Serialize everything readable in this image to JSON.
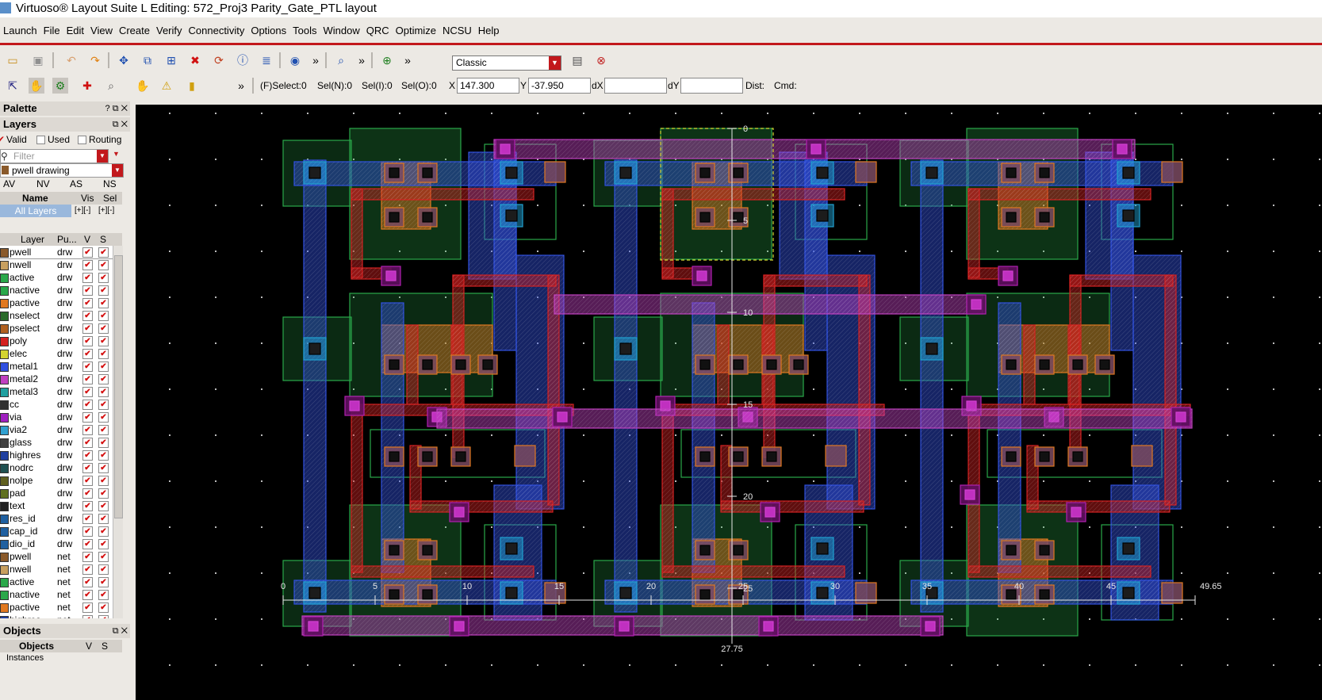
{
  "title": "Virtuoso® Layout Suite L Editing: 572_Proj3 Parity_Gate_PTL layout",
  "menu": [
    "Launch",
    "File",
    "Edit",
    "View",
    "Create",
    "Verify",
    "Connectivity",
    "Options",
    "Tools",
    "Window",
    "QRC",
    "Optimize",
    "NCSU",
    "Help"
  ],
  "toolbar": {
    "workspace": "Classic",
    "more": "»"
  },
  "status": {
    "f_select": "(F)Select:0",
    "sel_n": "Sel(N):0",
    "sel_i": "Sel(I):0",
    "sel_o": "Sel(O):0",
    "x_label": "X",
    "x_value": "147.300",
    "y_label": "Y",
    "y_value": "-37.950",
    "dx_label": "dX",
    "dx_value": "",
    "dy_label": "dY",
    "dy_value": "",
    "dist_label": "Dist:",
    "cmd_label": "Cmd:"
  },
  "palette": {
    "title": "Palette",
    "layers_title": "Layers",
    "valid": "Valid",
    "used": "Used",
    "routing": "Routing",
    "filter_placeholder": "Filter",
    "current_layer": "pwell drawing",
    "tabs": [
      "AV",
      "NV",
      "AS",
      "NS"
    ],
    "name_header": "Name",
    "vis_header": "Vis",
    "sel_header": "Sel",
    "all_layers": "All Layers",
    "col_layer": "Layer",
    "col_purpose": "Pu...",
    "col_v": "V",
    "col_s": "S",
    "layers": [
      {
        "name": "pwell",
        "purpose": "drw",
        "color": "#8a5a2b"
      },
      {
        "name": "nwell",
        "purpose": "drw",
        "color": "#c8a060"
      },
      {
        "name": "active",
        "purpose": "drw",
        "color": "#2aa84a"
      },
      {
        "name": "nactive",
        "purpose": "drw",
        "color": "#2aa84a"
      },
      {
        "name": "pactive",
        "purpose": "drw",
        "color": "#e07820"
      },
      {
        "name": "nselect",
        "purpose": "drw",
        "color": "#2a6a2a"
      },
      {
        "name": "pselect",
        "purpose": "drw",
        "color": "#b06020"
      },
      {
        "name": "poly",
        "purpose": "drw",
        "color": "#d42020"
      },
      {
        "name": "elec",
        "purpose": "drw",
        "color": "#d4d430"
      },
      {
        "name": "metal1",
        "purpose": "drw",
        "color": "#3050e0"
      },
      {
        "name": "metal2",
        "purpose": "drw",
        "color": "#c040c0"
      },
      {
        "name": "metal3",
        "purpose": "drw",
        "color": "#20a0a0"
      },
      {
        "name": "cc",
        "purpose": "drw",
        "color": "#303030"
      },
      {
        "name": "via",
        "purpose": "drw",
        "color": "#a020c0"
      },
      {
        "name": "via2",
        "purpose": "drw",
        "color": "#30a0d0"
      },
      {
        "name": "glass",
        "purpose": "drw",
        "color": "#404040"
      },
      {
        "name": "highres",
        "purpose": "drw",
        "color": "#2040a0"
      },
      {
        "name": "nodrc",
        "purpose": "drw",
        "color": "#205050"
      },
      {
        "name": "nolpe",
        "purpose": "drw",
        "color": "#606020"
      },
      {
        "name": "pad",
        "purpose": "drw",
        "color": "#607020"
      },
      {
        "name": "text",
        "purpose": "drw",
        "color": "#202020"
      },
      {
        "name": "res_id",
        "purpose": "drw",
        "color": "#2060a0"
      },
      {
        "name": "cap_id",
        "purpose": "drw",
        "color": "#2060a0"
      },
      {
        "name": "dio_id",
        "purpose": "drw",
        "color": "#2060a0"
      },
      {
        "name": "pwell",
        "purpose": "net",
        "color": "#8a5a2b"
      },
      {
        "name": "nwell",
        "purpose": "net",
        "color": "#c8a060"
      },
      {
        "name": "active",
        "purpose": "net",
        "color": "#2aa84a"
      },
      {
        "name": "nactive",
        "purpose": "net",
        "color": "#2aa84a"
      },
      {
        "name": "pactive",
        "purpose": "net",
        "color": "#e07820"
      },
      {
        "name": "highres",
        "purpose": "net",
        "color": "#2040a0"
      }
    ],
    "objects_title": "Objects",
    "objects_header": "Objects",
    "objects_v": "V",
    "objects_s": "S",
    "instances": "Instances"
  },
  "canvas": {
    "ruler_h": [
      "0",
      "5",
      "10",
      "15",
      "20",
      "25",
      "30",
      "35",
      "40",
      "45",
      "49.65"
    ],
    "ruler_v": [
      "0",
      "5",
      "10",
      "15",
      "20",
      "25"
    ],
    "ruler_bottom": "27.75"
  }
}
